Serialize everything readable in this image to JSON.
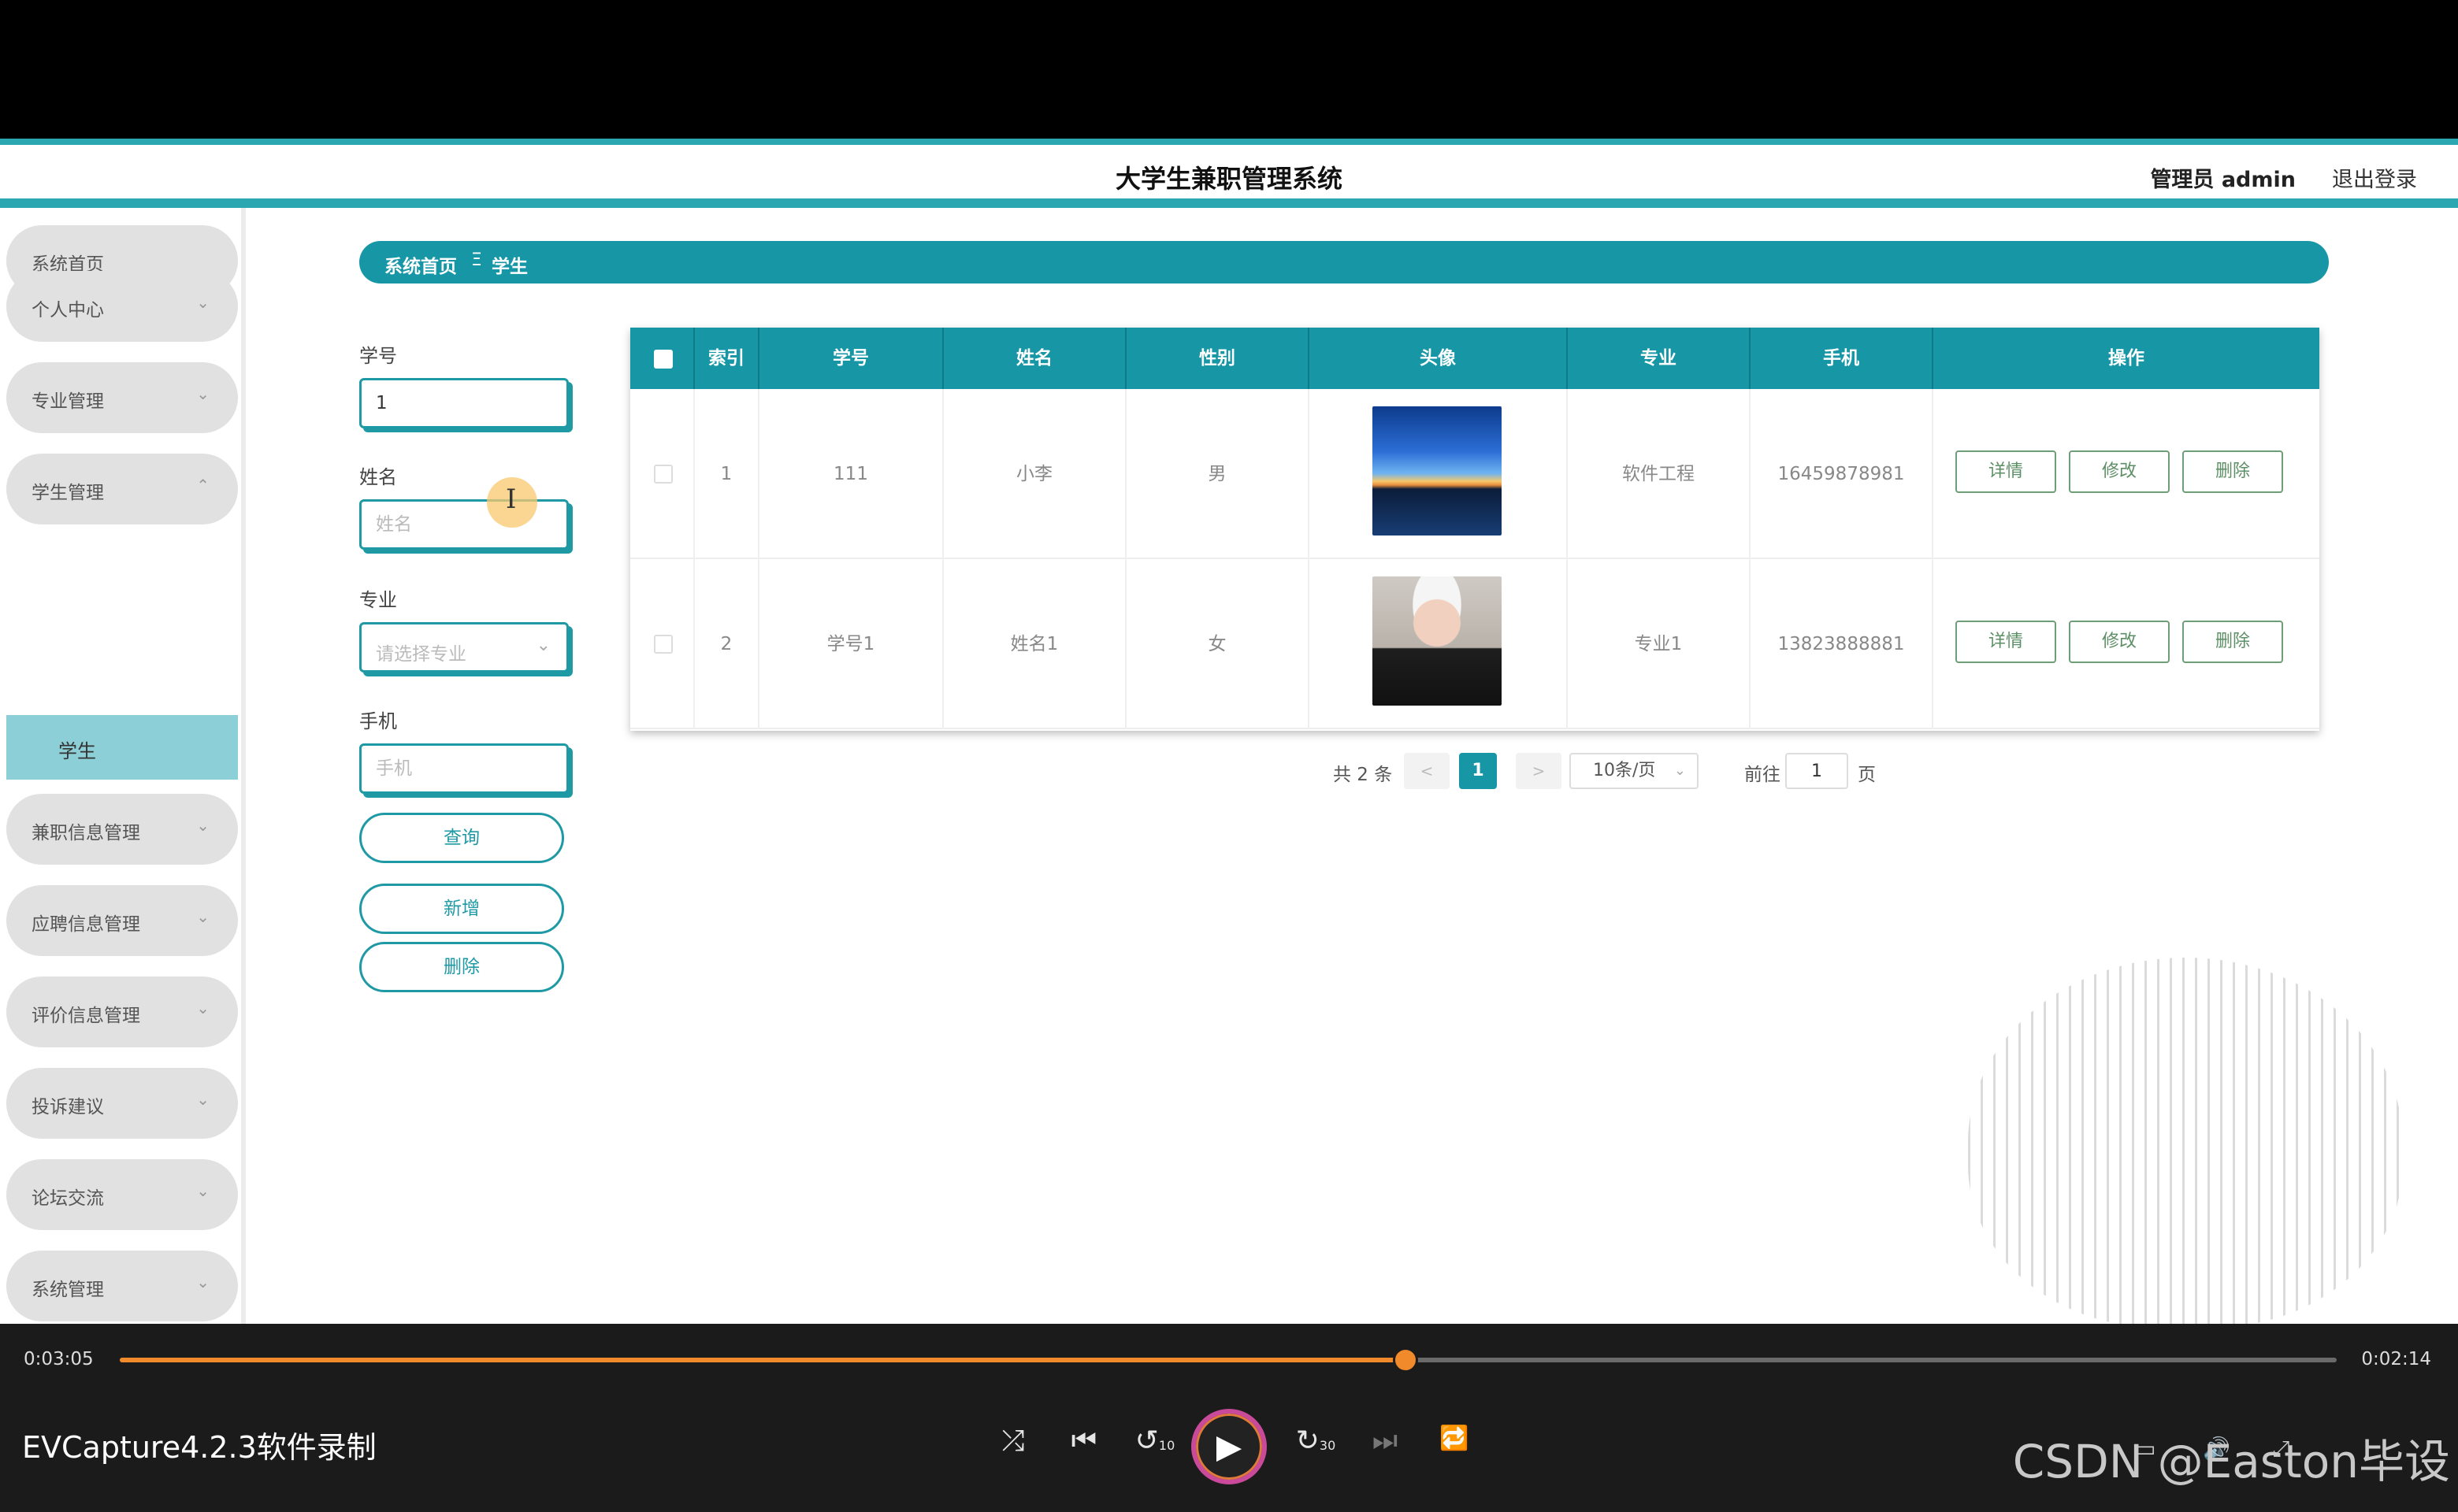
{
  "app": {
    "title": "大学生兼职管理系统",
    "user": "管理员 admin",
    "logout": "退出登录",
    "accent": "#1797a6"
  },
  "sidebar": {
    "items": [
      {
        "label": "系统首页",
        "chevron": ""
      },
      {
        "label": "个人中心",
        "chevron": "⌄"
      },
      {
        "label": "专业管理",
        "chevron": "⌄"
      },
      {
        "label": "学生管理",
        "chevron": "⌃"
      },
      {
        "label": "兼职信息管理",
        "chevron": "⌄"
      },
      {
        "label": "应聘信息管理",
        "chevron": "⌄"
      },
      {
        "label": "评价信息管理",
        "chevron": "⌄"
      },
      {
        "label": "投诉建议",
        "chevron": "⌄"
      },
      {
        "label": "论坛交流",
        "chevron": "⌄"
      },
      {
        "label": "系统管理",
        "chevron": "⌄"
      }
    ],
    "active_sub": "学生"
  },
  "breadcrumb": {
    "home": "系统首页",
    "sep": "Ξ",
    "current": "学生"
  },
  "search": {
    "student_no_label": "学号",
    "student_no_value": "1",
    "name_label": "姓名",
    "name_placeholder": "姓名",
    "major_label": "专业",
    "major_placeholder": "请选择专业",
    "phone_label": "手机",
    "phone_placeholder": "手机",
    "query_btn": "查询",
    "add_btn": "新增",
    "delete_btn": "删除"
  },
  "table": {
    "headers": [
      "索引",
      "学号",
      "姓名",
      "性别",
      "头像",
      "专业",
      "手机",
      "操作"
    ],
    "rows": [
      {
        "index": "1",
        "student_no": "111",
        "name": "小李",
        "gender": "男",
        "avatar": "sunset-photo",
        "major": "软件工程",
        "phone": "16459878981"
      },
      {
        "index": "2",
        "student_no": "学号1",
        "name": "姓名1",
        "gender": "女",
        "avatar": "girl-photo",
        "major": "专业1",
        "phone": "13823888881"
      }
    ],
    "actions": {
      "detail": "详情",
      "edit": "修改",
      "delete": "删除"
    }
  },
  "pagination": {
    "total": "共 2 条",
    "prev": "<",
    "next": ">",
    "current": "1",
    "page_size": "10条/页",
    "goto_label": "前往",
    "goto_value": "1",
    "page_suffix": "页"
  },
  "player": {
    "elapsed": "0:03:05",
    "remaining": "0:02:14",
    "progress": 0.58,
    "recorder_label": "EVCapture4.2.3软件录制",
    "watermark": "CSDN @Easton毕设",
    "controls": {
      "shuffle": "⤮",
      "prev": "⏮",
      "rewind": "↺",
      "play": "▶",
      "forward": "↻",
      "next": "⏭",
      "repeat": "🔁"
    },
    "rewind_seconds": "10",
    "forward_seconds": "30"
  }
}
